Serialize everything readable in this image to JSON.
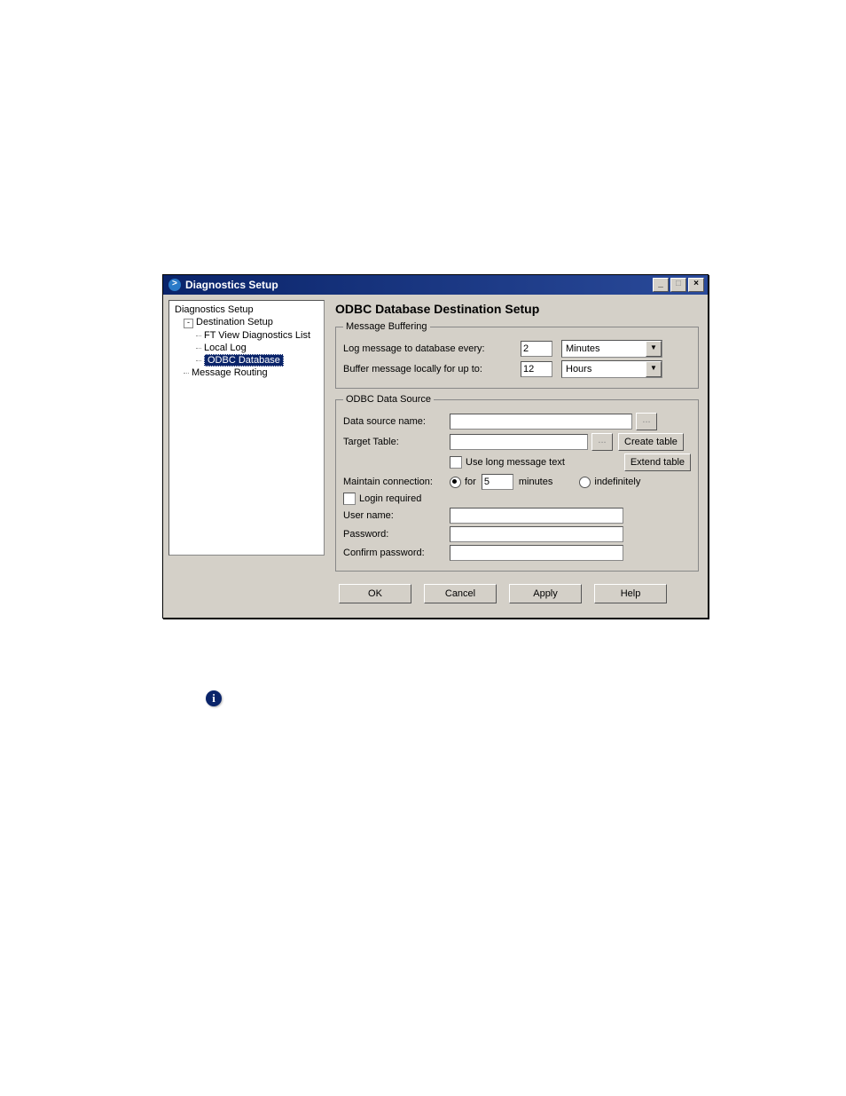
{
  "titlebar": {
    "title": "Diagnostics Setup",
    "min_label": "_",
    "max_label": "□",
    "close_label": "×"
  },
  "tree": {
    "root": "Diagnostics Setup",
    "dest_setup": "Destination Setup",
    "ftview": "FT View Diagnostics List",
    "local_log": "Local Log",
    "odbc": "ODBC Database",
    "routing": "Message Routing"
  },
  "heading": "ODBC Database Destination Setup",
  "buffering": {
    "legend": "Message Buffering",
    "log_label": "Log message to database every:",
    "log_value": "2",
    "log_unit": "Minutes",
    "buf_label": "Buffer message locally for up to:",
    "buf_value": "12",
    "buf_unit": "Hours"
  },
  "datasource": {
    "legend": "ODBC Data Source",
    "dsn_label": "Data source name:",
    "dsn_value": "",
    "table_label": "Target Table:",
    "table_value": "",
    "browse_label": "...",
    "create_table": "Create table",
    "extend_table": "Extend table",
    "long_msg": "Use long message text",
    "maintain_label": "Maintain connection:",
    "for_label": "for",
    "for_value": "5",
    "minutes_label": "minutes",
    "indef_label": "indefinitely",
    "login_req": "Login required",
    "user_label": "User name:",
    "user_value": "",
    "pwd_label": "Password:",
    "pwd_value": "",
    "confirm_label": "Confirm password:",
    "confirm_value": ""
  },
  "buttons": {
    "ok": "OK",
    "cancel": "Cancel",
    "apply": "Apply",
    "help": "Help"
  },
  "info_icon": "i"
}
